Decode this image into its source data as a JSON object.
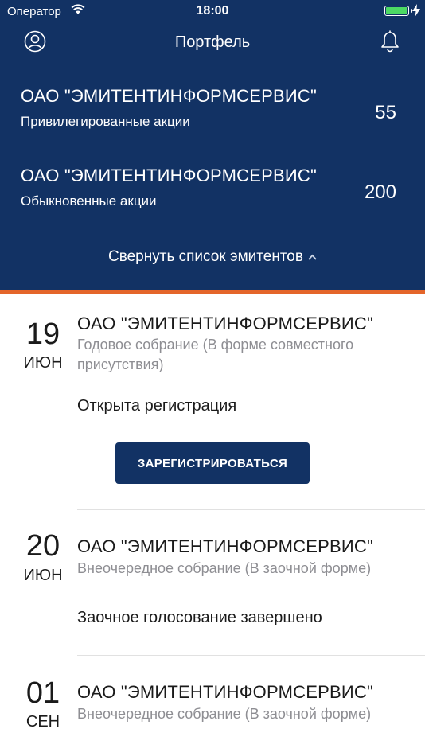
{
  "status_bar": {
    "carrier": "Оператор",
    "time": "18:00",
    "battery_level": 1.0
  },
  "nav": {
    "title": "Портфель",
    "left_icon": "profile-icon",
    "right_icon": "bell-icon"
  },
  "holdings": [
    {
      "issuer": "ОАО \"ЭМИТЕНТИНФОРМСЕРВИС\"",
      "share_type": "Привилегированные акции",
      "quantity": "55"
    },
    {
      "issuer": "ОАО \"ЭМИТЕНТИНФОРМСЕРВИС\"",
      "share_type": "Обыкновенные акции",
      "quantity": "200"
    }
  ],
  "collapse_label": "Свернуть список эмитентов",
  "meetings": [
    {
      "day": "19",
      "month": "ИЮН",
      "issuer": "ОАО \"ЭМИТЕНТИНФОРМСЕРВИС\"",
      "type": "Годовое собрание (В форме совместного присутствия)",
      "status": "Открыта регистрация",
      "button_label": "ЗАРЕГИСТРИРОВАТЬСЯ"
    },
    {
      "day": "20",
      "month": "ИЮН",
      "issuer": "ОАО \"ЭМИТЕНТИНФОРМСЕРВИС\"",
      "type": "Внеочередное собрание (В заочной форме)",
      "status": "Заочное голосование завершено"
    },
    {
      "day": "01",
      "month": "СЕН",
      "issuer": "ОАО \"ЭМИТЕНТИНФОРМСЕРВИС\"",
      "type": "Внеочередное собрание (В заочной форме)"
    }
  ],
  "colors": {
    "primary": "#123264",
    "accent": "#e4652a",
    "secondary_text": "#8e8e93",
    "battery": "#4cd964"
  }
}
